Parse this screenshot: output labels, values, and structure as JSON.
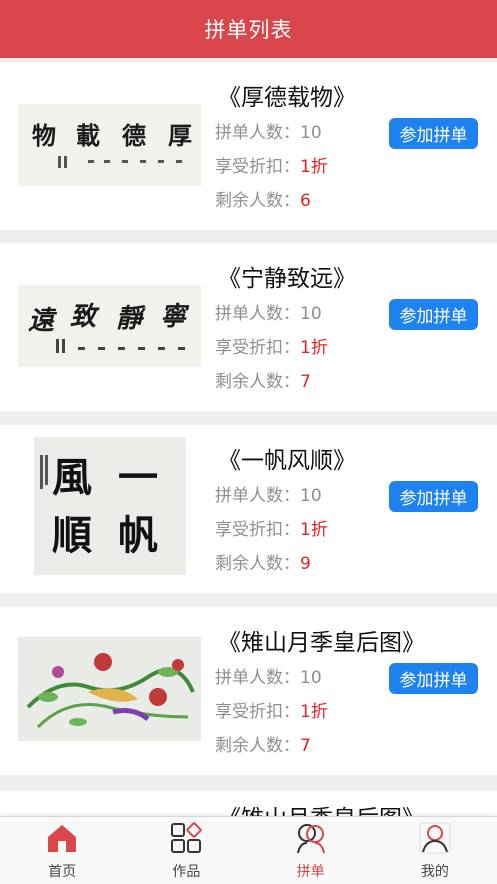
{
  "header": {
    "title": "拼单列表"
  },
  "items": [
    {
      "title": "《厚德载物》",
      "count_label": "拼单人数：",
      "count": "10",
      "discount_label": "享受折扣：",
      "discount": "1折",
      "remain_label": "剩余人数：",
      "remain": "6",
      "button": "参加拼单",
      "image": "calligraphy-scroll"
    },
    {
      "title": "《宁静致远》",
      "count_label": "拼单人数：",
      "count": "10",
      "discount_label": "享受折扣：",
      "discount": "1折",
      "remain_label": "剩余人数：",
      "remain": "7",
      "button": "参加拼单",
      "image": "calligraphy-scroll"
    },
    {
      "title": "《一帆风顺》",
      "count_label": "拼单人数：",
      "count": "10",
      "discount_label": "享受折扣：",
      "discount": "1折",
      "remain_label": "剩余人数：",
      "remain": "9",
      "button": "参加拼单",
      "image": "calligraphy-square"
    },
    {
      "title": "《雉山月季皇后图》",
      "count_label": "拼单人数：",
      "count": "10",
      "discount_label": "享受折扣：",
      "discount": "1折",
      "remain_label": "剩余人数：",
      "remain": "7",
      "button": "参加拼单",
      "image": "flower-painting"
    },
    {
      "title": "《雉山月季皇后图》"
    }
  ],
  "tabbar": [
    {
      "label": "首页",
      "icon": "home-icon"
    },
    {
      "label": "作品",
      "icon": "works-icon"
    },
    {
      "label": "拼单",
      "icon": "group-buy-icon",
      "active": true
    },
    {
      "label": "我的",
      "icon": "profile-icon"
    }
  ],
  "colors": {
    "header": "#d9474c",
    "button": "#1e83f0",
    "accent_red": "#e82020"
  }
}
